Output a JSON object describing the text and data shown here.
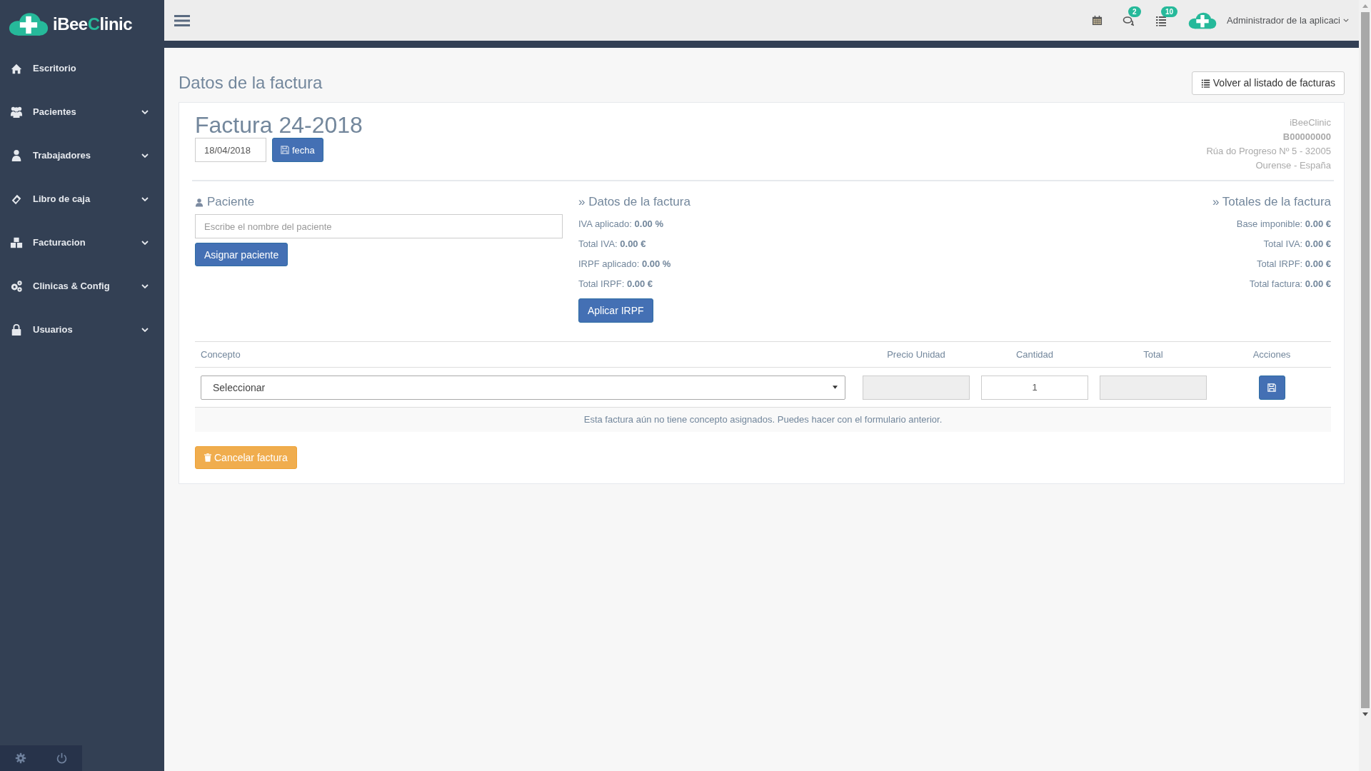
{
  "brand": {
    "prefix": "iBee",
    "highlight": "C",
    "suffix": "linic"
  },
  "sidebar": {
    "items": [
      {
        "label": "Escritorio",
        "expandable": false
      },
      {
        "label": "Pacientes",
        "expandable": true
      },
      {
        "label": "Trabajadores",
        "expandable": true
      },
      {
        "label": "Libro de caja",
        "expandable": true
      },
      {
        "label": "Facturacion",
        "expandable": true
      },
      {
        "label": "Clinicas & Config",
        "expandable": true
      },
      {
        "label": "Usuarios",
        "expandable": true
      }
    ]
  },
  "topbar": {
    "badges": [
      {
        "kind": "messages",
        "count": "2"
      },
      {
        "kind": "tasks",
        "count": "10"
      }
    ],
    "user": "Administrador de la aplicaci"
  },
  "page": {
    "title": "Datos de la factura",
    "back_button": "Volver al listado de facturas"
  },
  "invoice": {
    "title": "Factura 24-2018",
    "date": "18/04/2018",
    "date_button": "fecha",
    "company": [
      "iBeeClinic",
      "B00000000",
      "Rúa do Progreso Nº 5 - 32005",
      "Ourense - España"
    ],
    "patient": {
      "heading": "Paciente",
      "placeholder": "Escribe el nombre del paciente",
      "button": "Asignar paciente"
    },
    "data": {
      "heading": "» Datos de la factura",
      "lines": [
        {
          "label": "IVA aplicado: ",
          "value": "0.00 %"
        },
        {
          "label": "Total IVA: ",
          "value": "0.00 €"
        },
        {
          "label": "IRPF aplicado: ",
          "value": "0.00 %"
        },
        {
          "label": "Total IRPF: ",
          "value": "0.00 €"
        }
      ],
      "button": "Aplicar IRPF"
    },
    "totals": {
      "heading": "» Totales de la factura",
      "lines": [
        {
          "label": "Base imponible: ",
          "value": "0.00 €"
        },
        {
          "label": "Total IVA: ",
          "value": "0.00 €"
        },
        {
          "label": "Total IRPF: ",
          "value": "0.00 €"
        },
        {
          "label": "Total factura: ",
          "value": "0.00 €"
        }
      ]
    }
  },
  "table": {
    "columns": [
      "Concepto",
      "Precio Unidad",
      "Cantidad",
      "Total",
      "Acciones"
    ],
    "row": {
      "concept": "Seleccionar",
      "quantity": "1"
    },
    "empty_message": "Esta factura aún no tiene concepto asignados. Puedes hacer con el formulario anterior."
  },
  "cancel_button": "Cancelar factura"
}
